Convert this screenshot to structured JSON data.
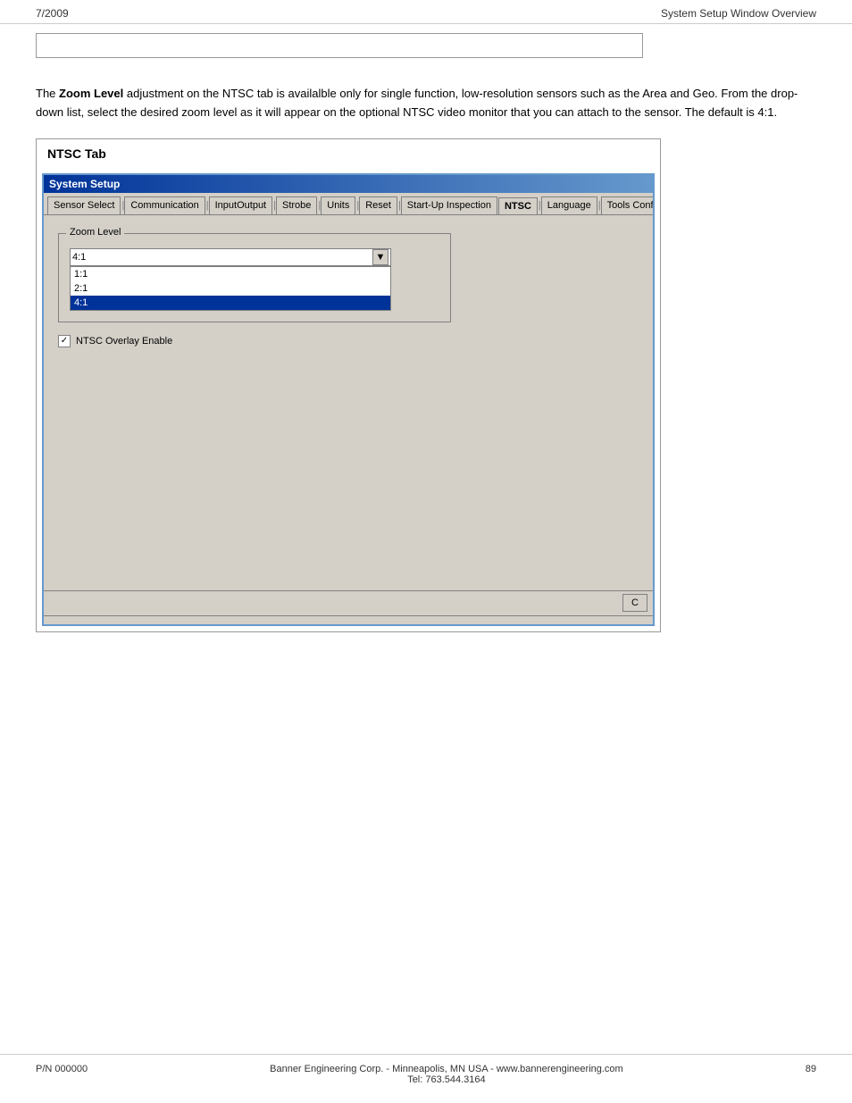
{
  "header": {
    "left": "7/2009",
    "right": "System Setup Window Overview"
  },
  "description": {
    "part1": "The ",
    "bold": "Zoom Level",
    "part2": " adjustment on the NTSC tab is availalble only for single function, low-resolution sensors such as the Area and Geo. From the drop-down list, select the desired zoom level as it will appear on the optional NTSC video monitor that you can attach to the sensor. The default is 4:1."
  },
  "ntsc_box": {
    "title": "NTSC Tab"
  },
  "system_setup": {
    "titlebar": "System Setup",
    "tabs": [
      {
        "label": "Sensor Select",
        "separator": true
      },
      {
        "label": "Communication",
        "separator": true
      },
      {
        "label": "InputOutput",
        "separator": true
      },
      {
        "label": "Strobe",
        "separator": true
      },
      {
        "label": "Units",
        "separator": true
      },
      {
        "label": "Reset",
        "separator": true
      },
      {
        "label": "Start-Up Inspection",
        "separator": true
      },
      {
        "label": "NTSC",
        "active": true,
        "separator": true
      },
      {
        "label": "Language",
        "separator": true
      },
      {
        "label": "Tools Configura..."
      }
    ]
  },
  "zoom_level": {
    "group_label": "Zoom Level",
    "selected_value": "4:1",
    "options": [
      {
        "label": "1:1",
        "selected": false
      },
      {
        "label": "2:1",
        "selected": false
      },
      {
        "label": "4:1",
        "selected": true
      }
    ]
  },
  "ntsc_overlay": {
    "label": "NTSC Overlay Enable",
    "checked": true,
    "check_char": "✓"
  },
  "buttons": {
    "ok": "C"
  },
  "footer": {
    "left": "P/N 000000",
    "center_line1": "Banner Engineering Corp. - Minneapolis, MN USA - www.bannerengineering.com",
    "center_line2": "Tel: 763.544.3164",
    "right": "89"
  }
}
